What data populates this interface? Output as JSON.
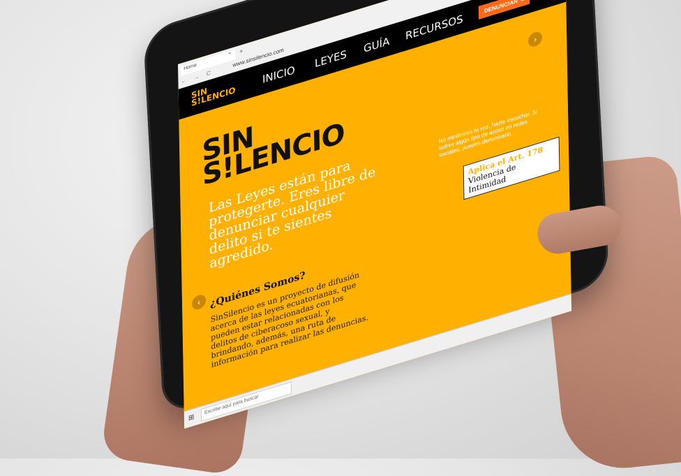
{
  "browser": {
    "tab_title": "Home",
    "tab_close": "×",
    "new_tab": "+",
    "nav_icons": "← → C",
    "url": "www.sinsilencio.com",
    "window_controls": "– ◻ ×",
    "tool_icons": "☆ ⋮"
  },
  "navbar": {
    "logo_line1": "SIN",
    "logo_line2": "S!LENCIO",
    "items": [
      "INICIO",
      "LEYES",
      "GUÍA",
      "RECURSOS"
    ],
    "cta": "DENUNCIAR ✎"
  },
  "hero": {
    "logo_line1": "SIN",
    "logo_line2": "S!LENCIO",
    "headline": "Las Leyes están para protegerte. Eres libre de denunciar cualquier delito si te sientes agredido.",
    "side_text": "No minimices tu voz, hazte escuchar. Si sufres algún tipo de acoso en redes sociales, puedes denunciarlo.",
    "badge_line1": "Aplica el Art. 178",
    "badge_line2": "Violencia de Intimidad",
    "arrow_left": "‹",
    "arrow_right": "›",
    "about_title": "¿Quiénes Somos?",
    "about_text": "SinSilencio es un proyecto de difusión acerca de las leyes ecuatorianas, que pueden estar relacionadas con los delitos de ciberacoso sexual, y brindando, además, una ruta de información para realizar las denuncias."
  },
  "taskbar": {
    "search_placeholder": "Escribe aquí para buscar"
  },
  "colors": {
    "brand_yellow": "#ffb000",
    "cta_orange": "#ff6a1a",
    "navbar_black": "#000000"
  }
}
